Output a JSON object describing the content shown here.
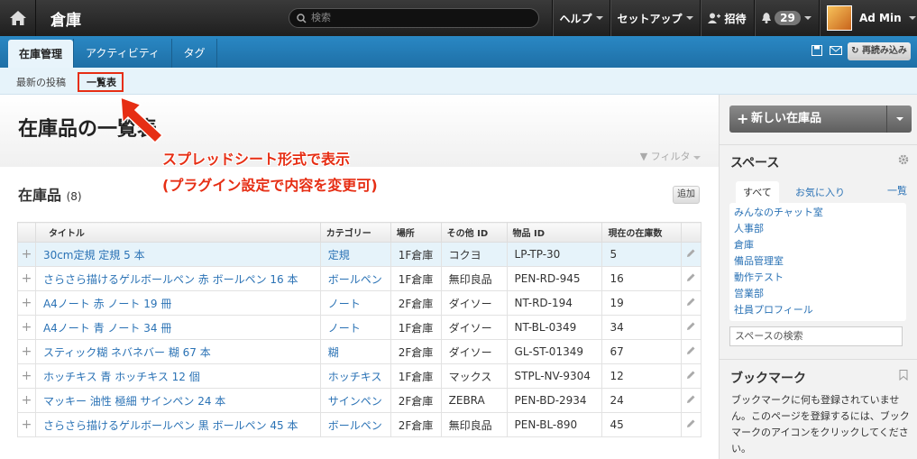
{
  "topbar": {
    "app_title": "倉庫",
    "search_placeholder": "検索",
    "help": "ヘルプ",
    "setup": "セットアップ",
    "invite": "招待",
    "notif_count": "29",
    "user": "Ad Min"
  },
  "tabs": [
    "在庫管理",
    "アクティビティ",
    "タグ"
  ],
  "reload_label": "再読み込み",
  "subnav": {
    "recent": "最新の投稿",
    "list": "一覧表"
  },
  "page_title": "在庫品の一覧表",
  "filter_label": "フィルタ",
  "section": {
    "title": "在庫品",
    "count": "(8)",
    "add": "追加"
  },
  "annotation": {
    "line1": "スプレッドシート形式で表示",
    "line2": "(プラグイン設定で内容を変更可)"
  },
  "table": {
    "headers": [
      "タイトル",
      "カテゴリー",
      "場所",
      "その他 ID",
      "物品 ID",
      "現在の在庫数"
    ],
    "rows": [
      [
        "30cm定規 定規 5 本",
        "定規",
        "1F倉庫",
        "コクヨ",
        "LP-TP-30",
        "5"
      ],
      [
        "さらさら描けるゲルボールペン 赤 ボールペン 16 本",
        "ボールペン",
        "1F倉庫",
        "無印良品",
        "PEN-RD-945",
        "16"
      ],
      [
        "A4ノート 赤 ノート 19 冊",
        "ノート",
        "2F倉庫",
        "ダイソー",
        "NT-RD-194",
        "19"
      ],
      [
        "A4ノート 青 ノート 34 冊",
        "ノート",
        "1F倉庫",
        "ダイソー",
        "NT-BL-0349",
        "34"
      ],
      [
        "スティック糊 ネバネバー 糊 67 本",
        "糊",
        "2F倉庫",
        "ダイソー",
        "GL-ST-01349",
        "67"
      ],
      [
        "ホッチキス 青 ホッチキス 12 個",
        "ホッチキス",
        "1F倉庫",
        "マックス",
        "STPL-NV-9304",
        "12"
      ],
      [
        "マッキー 油性 極細 サインペン 24 本",
        "サインペン",
        "2F倉庫",
        "ZEBRA",
        "PEN-BD-2934",
        "24"
      ],
      [
        "さらさら描けるゲルボールペン 黒 ボールペン 45 本",
        "ボールペン",
        "2F倉庫",
        "無印良品",
        "PEN-BL-890",
        "45"
      ]
    ]
  },
  "sidebar": {
    "new_item": "新しい在庫品",
    "spaces_title": "スペース",
    "tab_all": "すべて",
    "tab_fav": "お気に入り",
    "tab_list": "一覧",
    "spaces": [
      "みんなのチャット室",
      "人事部",
      "倉庫",
      "備品管理室",
      "動作テスト",
      "営業部",
      "社員プロフィール"
    ],
    "space_search": "スペースの検索",
    "bookmark_title": "ブックマーク",
    "bookmark_text": "ブックマークに何も登録されていません。このページを登録するには、ブックマークのアイコンをクリックしてください。"
  }
}
